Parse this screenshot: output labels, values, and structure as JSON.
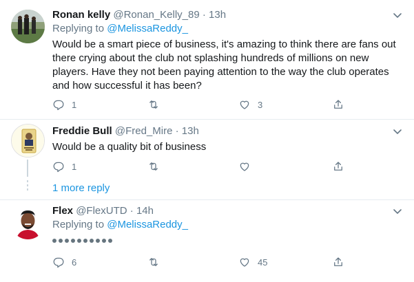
{
  "tweets": [
    {
      "name": "Ronan kelly",
      "handle": "@Ronan_Kelly_89",
      "dot": "·",
      "time": "13h",
      "reply_prefix": "Replying to ",
      "reply_mention": "@MelissaReddy_",
      "text": "Would be a smart piece of business, it's amazing to think there are fans out there crying about the club not splashing hundreds of millions on new players. Have they not been paying attention to the way the club operates and how successful it has been?",
      "replies": "1",
      "retweets": "",
      "likes": "3"
    },
    {
      "name": "Freddie Bull",
      "handle": "@Fred_Mire",
      "dot": "·",
      "time": "13h",
      "text": "Would be a quality bit of business",
      "replies": "1",
      "retweets": "",
      "likes": ""
    },
    {
      "name": "Flex",
      "handle": "@FlexUTD",
      "dot": "·",
      "time": "14h",
      "reply_prefix": "Replying to ",
      "reply_mention": "@MelissaReddy_",
      "replies": "6",
      "retweets": "",
      "likes": "45"
    }
  ],
  "more_replies": "1 more reply",
  "icons": {
    "reply": "reply-icon",
    "retweet": "retweet-icon",
    "like": "heart-icon",
    "share": "share-icon",
    "caret": "chevron-down-icon"
  },
  "colors": {
    "link": "#1b95e0",
    "muted": "#657786",
    "text": "#14171a",
    "divider": "#e6ecf0"
  }
}
